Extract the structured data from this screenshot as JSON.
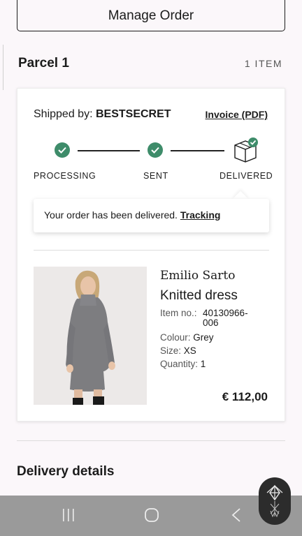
{
  "header": {
    "manage_order_label": "Manage Order"
  },
  "parcel": {
    "title": "Parcel 1",
    "item_count": "1 ITEM"
  },
  "shipment": {
    "shipped_by_label": "Shipped by:",
    "carrier": "BESTSECRET",
    "invoice_label": "Invoice (PDF)",
    "steps": [
      {
        "label": "PROCESSING",
        "done": true
      },
      {
        "label": "SENT",
        "done": true
      },
      {
        "label": "DELIVERED",
        "done": true
      }
    ],
    "status_message": "Your order has been delivered.",
    "tracking_label": "Tracking",
    "status_color": "#3e8c6a"
  },
  "item": {
    "brand": "Emilio Sarto",
    "name": "Knitted dress",
    "item_no_label": "Item no.:",
    "item_no": "40130966-006",
    "colour_label": "Colour:",
    "colour": "Grey",
    "size_label": "Size:",
    "size": "XS",
    "quantity_label": "Quantity:",
    "quantity": "1",
    "price": "€ 112,00"
  },
  "delivery_details_title": "Delivery details",
  "system_nav": {
    "recents": "recents-icon",
    "home": "home-icon",
    "back": "back-icon"
  },
  "assistant_button": {
    "icon": "brand-assistant-icon"
  }
}
